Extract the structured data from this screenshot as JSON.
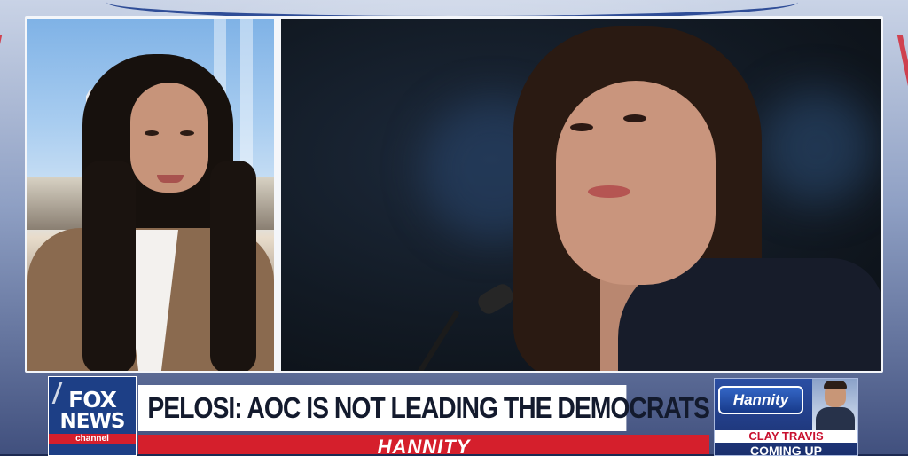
{
  "network": {
    "logo_line1": "FOX",
    "logo_line2": "NEWS",
    "logo_line3": "channel",
    "brand_colors": {
      "blue": "#1d3f86",
      "red": "#d51f2c"
    }
  },
  "lower_third": {
    "headline": "PELOSI: AOC IS NOT LEADING THE DEMOCRATS RIGHT NOW",
    "show_name": "HANNITY"
  },
  "promo": {
    "logo_text": "Hannity",
    "guest_name": "CLAY TRAVIS",
    "tease": "COMING UP"
  },
  "panels": {
    "left": {
      "icon": "anchor-video-feed"
    },
    "right": {
      "icon": "subject-photo"
    }
  }
}
